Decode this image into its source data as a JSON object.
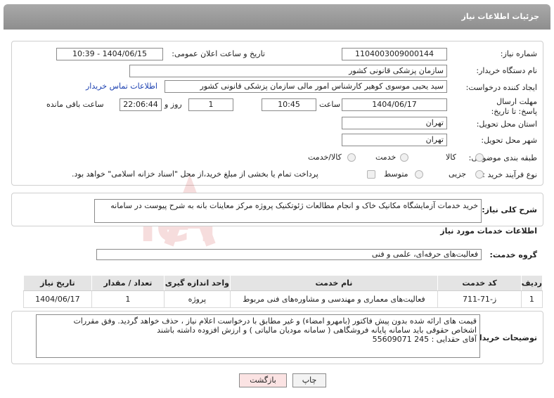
{
  "header": {
    "title": "جزئیات اطلاعات نیاز"
  },
  "form": {
    "need_number_label": "شماره نیاز:",
    "need_number": "1104003009000144",
    "announce_label": "تاریخ و ساعت اعلان عمومی:",
    "announce_value": "1404/06/15 - 10:39",
    "buyer_org_label": "نام دستگاه خریدار:",
    "buyer_org": "سازمان پزشکی قانونی کشور",
    "creator_label": "ایجاد کننده درخواست:",
    "creator": "سید یحیی موسوی کوهیر کارشناس امور مالی سازمان پزشکی قانونی کشور",
    "contact_link": "اطلاعات تماس خریدار",
    "deadline_label": "مهلت ارسال پاسخ: تا تاریخ:",
    "deadline_date": "1404/06/17",
    "time_label": "ساعت",
    "deadline_time": "10:45",
    "days_value": "1",
    "days_label": "روز و",
    "remaining_time": "22:06:44",
    "remaining_label": "ساعت باقی مانده",
    "province_label": "استان محل تحویل:",
    "province": "تهران",
    "city_label": "شهر محل تحویل:",
    "city": "تهران",
    "category_label": "طبقه بندی موضوعی:",
    "category_options": [
      "کالا",
      "خدمت",
      "کالا/خدمت"
    ],
    "process_label": "نوع فرآیند خرید :",
    "process_options": [
      "جزیی",
      "متوسط"
    ],
    "payment_note": "پرداخت تمام یا بخشی از مبلغ خرید،از محل \"اسناد خزانه اسلامی\" خواهد بود."
  },
  "summary": {
    "label": "شرح کلی نیاز:",
    "text": "خرید خدمات آزمایشگاه مکانیک خاک و انجام مطالعات ژئوتکنیک پروژه مرکز معاینات بانه  به شرح پیوست در سامانه"
  },
  "services": {
    "section_title": "اطلاعات خدمات مورد نیاز",
    "group_label": "گروه خدمت:",
    "group_value": "فعالیت‌های حرفه‌ای، علمی و فنی",
    "columns": [
      "ردیف",
      "کد خدمت",
      "نام خدمت",
      "واحد اندازه گیری",
      "تعداد / مقدار",
      "تاریخ نیاز"
    ],
    "rows": [
      [
        "1",
        "ز-71-711",
        "فعالیت‌های معماری و مهندسی و مشاوره‌های فنی مربوط",
        "پروژه",
        "1",
        "1404/06/17"
      ]
    ]
  },
  "buyer_notes": {
    "label": "توضیحات خریدار:",
    "line1": "قیمت های ارائه شده بدون پیش فاکتور (بامهرو امضاء) و غیر مطابق با درخواست اعلام نیاز  ، حذف خواهد گردید. وفق مقررات",
    "line2": "اشخاص حقوقی باید سامانه پایانه فروشگاهی ( سامانه مودیان مالیاتی ) و ارزش افزوده  داشته باشند",
    "line3": "آقای حقدایی  :   245       55609071"
  },
  "buttons": {
    "print": "چاپ",
    "back": "بازگشت"
  },
  "colors": {
    "header": "#9a9a9a",
    "link": "#1a3fb0",
    "back_button": "#fbe3e3"
  },
  "watermark_icon": "ariatender-logo"
}
